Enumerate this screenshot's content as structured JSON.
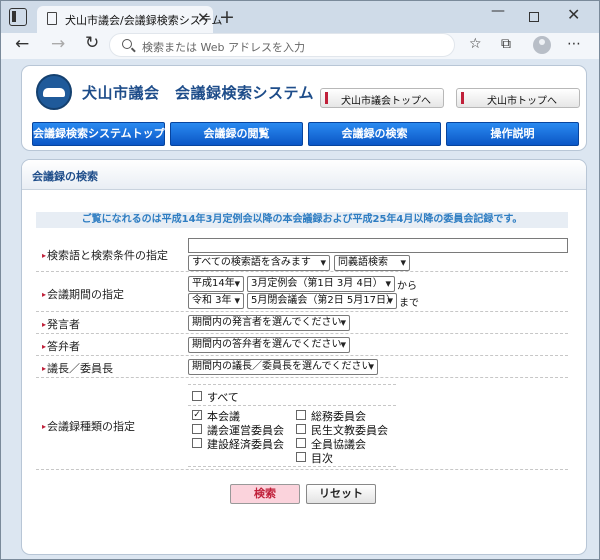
{
  "browser": {
    "tab_title": "犬山市議会/会議録検索システム",
    "address_placeholder": "検索または Web アドレスを入力"
  },
  "header": {
    "site_title": "犬山市議会　会議録検索システム",
    "links": [
      "犬山市議会トップへ",
      "犬山市トップへ"
    ],
    "nav": [
      "会議録検索システムトップ",
      "会議録の閲覧",
      "会議録の検索",
      "操作説明"
    ]
  },
  "search": {
    "heading": "会議録の検索",
    "notice": "ご覧になれるのは平成14年3月定例会以降の本会議録および平成25年4月以降の委員会記録です。",
    "keyword": {
      "label": "検索語と検索条件の指定",
      "value": "",
      "condition": "すべての検索語を含みます",
      "synonym": "同義語検索"
    },
    "period": {
      "label": "会議期間の指定",
      "from_era": "平成14年",
      "from_session": "3月定例会（第1日 3月 4日）",
      "from_suffix": "から",
      "to_era": "令和 3年",
      "to_session": "5月閉会議会（第2日 5月17日）",
      "to_suffix": "まで"
    },
    "speaker": {
      "label": "発言者",
      "value": "期間内の発言者を選んでください"
    },
    "answerer": {
      "label": "答弁者",
      "value": "期間内の答弁者を選んでください"
    },
    "chair": {
      "label": "議長／委員長",
      "value": "期間内の議長／委員長を選んでください"
    },
    "meeting_types": {
      "label": "会議録種類の指定",
      "all": {
        "label": "すべて",
        "checked": false
      },
      "left": [
        {
          "label": "本会議",
          "checked": true
        },
        {
          "label": "議会運営委員会",
          "checked": false
        },
        {
          "label": "建設経済委員会",
          "checked": false
        }
      ],
      "right": [
        {
          "label": "総務委員会",
          "checked": false
        },
        {
          "label": "民生文教委員会",
          "checked": false
        },
        {
          "label": "全員協議会",
          "checked": false
        },
        {
          "label": "目次",
          "checked": false
        }
      ]
    },
    "buttons": {
      "search": "検索",
      "reset": "リセット"
    }
  }
}
